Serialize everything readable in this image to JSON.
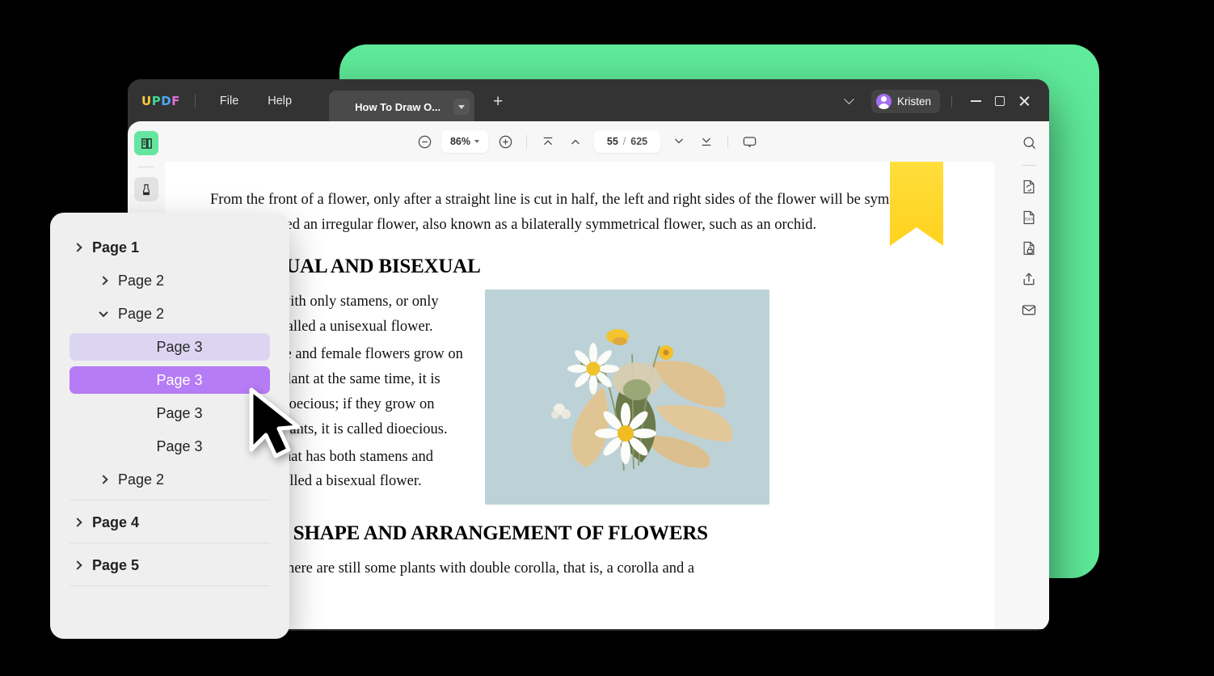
{
  "window": {
    "logo": {
      "l1": "U",
      "l2": "P",
      "l3": "D",
      "l4": "F"
    },
    "menus": [
      {
        "label": "File",
        "name": "menu-file"
      },
      {
        "label": "Help",
        "name": "menu-help"
      }
    ],
    "tab": {
      "title": "How To Draw O...",
      "new_tab": "+"
    },
    "user": {
      "name": "Kristen"
    }
  },
  "toolbar": {
    "zoom": "86%",
    "current_page": "55",
    "separator": "/",
    "total_pages": "625",
    "icons": [
      "zoom-out-icon",
      "zoom-in-icon",
      "first-page-icon",
      "previous-page-icon",
      "next-page-icon",
      "last-page-icon",
      "comment-icon"
    ]
  },
  "left_rail": {
    "items": [
      {
        "name": "reader-mode-icon",
        "active": true
      },
      {
        "name": "highlighter-icon",
        "active": false
      }
    ]
  },
  "right_rail": {
    "items": [
      "search-icon",
      "convert-pdf-icon",
      "pdf-a-icon",
      "protect-document-icon",
      "share-icon",
      "email-icon"
    ],
    "pdfa_label": "PDF/A"
  },
  "document": {
    "paragraph1": "From the front of a flower, only after a straight line is cut in half, the left and right sides of the flower will be symmetrical, which is called an irregular flower, also known as a bilaterally symmetrical flower, such as an orchid.",
    "heading1": "UNISEXUAL AND BISEXUAL",
    "bullets": [
      "A flower with only stamens, or only pistils, is called a unisexual flower.",
      "When male and female flowers grow on the same plant at the same time, it is called monoecious; if they grow on different plants, it is called dioecious.",
      "A flower that has both stamens and pistils is called a bisexual flower."
    ],
    "bullet_marker": "•",
    "heading2": "COLOR, SHAPE AND ARRANGEMENT OF FLOWERS",
    "paragraph2": "In addition, there are still some plants with double corolla, that is, a corolla and a",
    "image_alt": "pressed-dried-flowers-photo"
  },
  "outline_panel": {
    "rows": [
      {
        "label": "Page 1",
        "level": 1,
        "chevron": "right",
        "state": "none"
      },
      {
        "label": "Page 2",
        "level": 2,
        "chevron": "right",
        "state": "none"
      },
      {
        "label": "Page 2",
        "level": 2,
        "chevron": "down",
        "state": "none"
      },
      {
        "label": "Page 3",
        "level": 3,
        "chevron": "none",
        "state": "soft"
      },
      {
        "label": "Page 3",
        "level": 3,
        "chevron": "none",
        "state": "hard"
      },
      {
        "label": "Page 3",
        "level": 3,
        "chevron": "none",
        "state": "none"
      },
      {
        "label": "Page 3",
        "level": 3,
        "chevron": "none",
        "state": "none"
      },
      {
        "label": "Page 2",
        "level": 2,
        "chevron": "right",
        "state": "none"
      },
      {
        "label": "Page 4",
        "level": 1,
        "chevron": "right",
        "state": "none"
      },
      {
        "label": "Page 5",
        "level": 1,
        "chevron": "right",
        "state": "none"
      }
    ]
  },
  "colors": {
    "accent_green": "#5feb9a",
    "selected_purple": "#b57cf5",
    "hover_lavender": "#dcd5f2",
    "bookmark_yellow": "#ffd21e",
    "window_chrome": "#333333",
    "rail_active_green": "#64e6a0"
  }
}
